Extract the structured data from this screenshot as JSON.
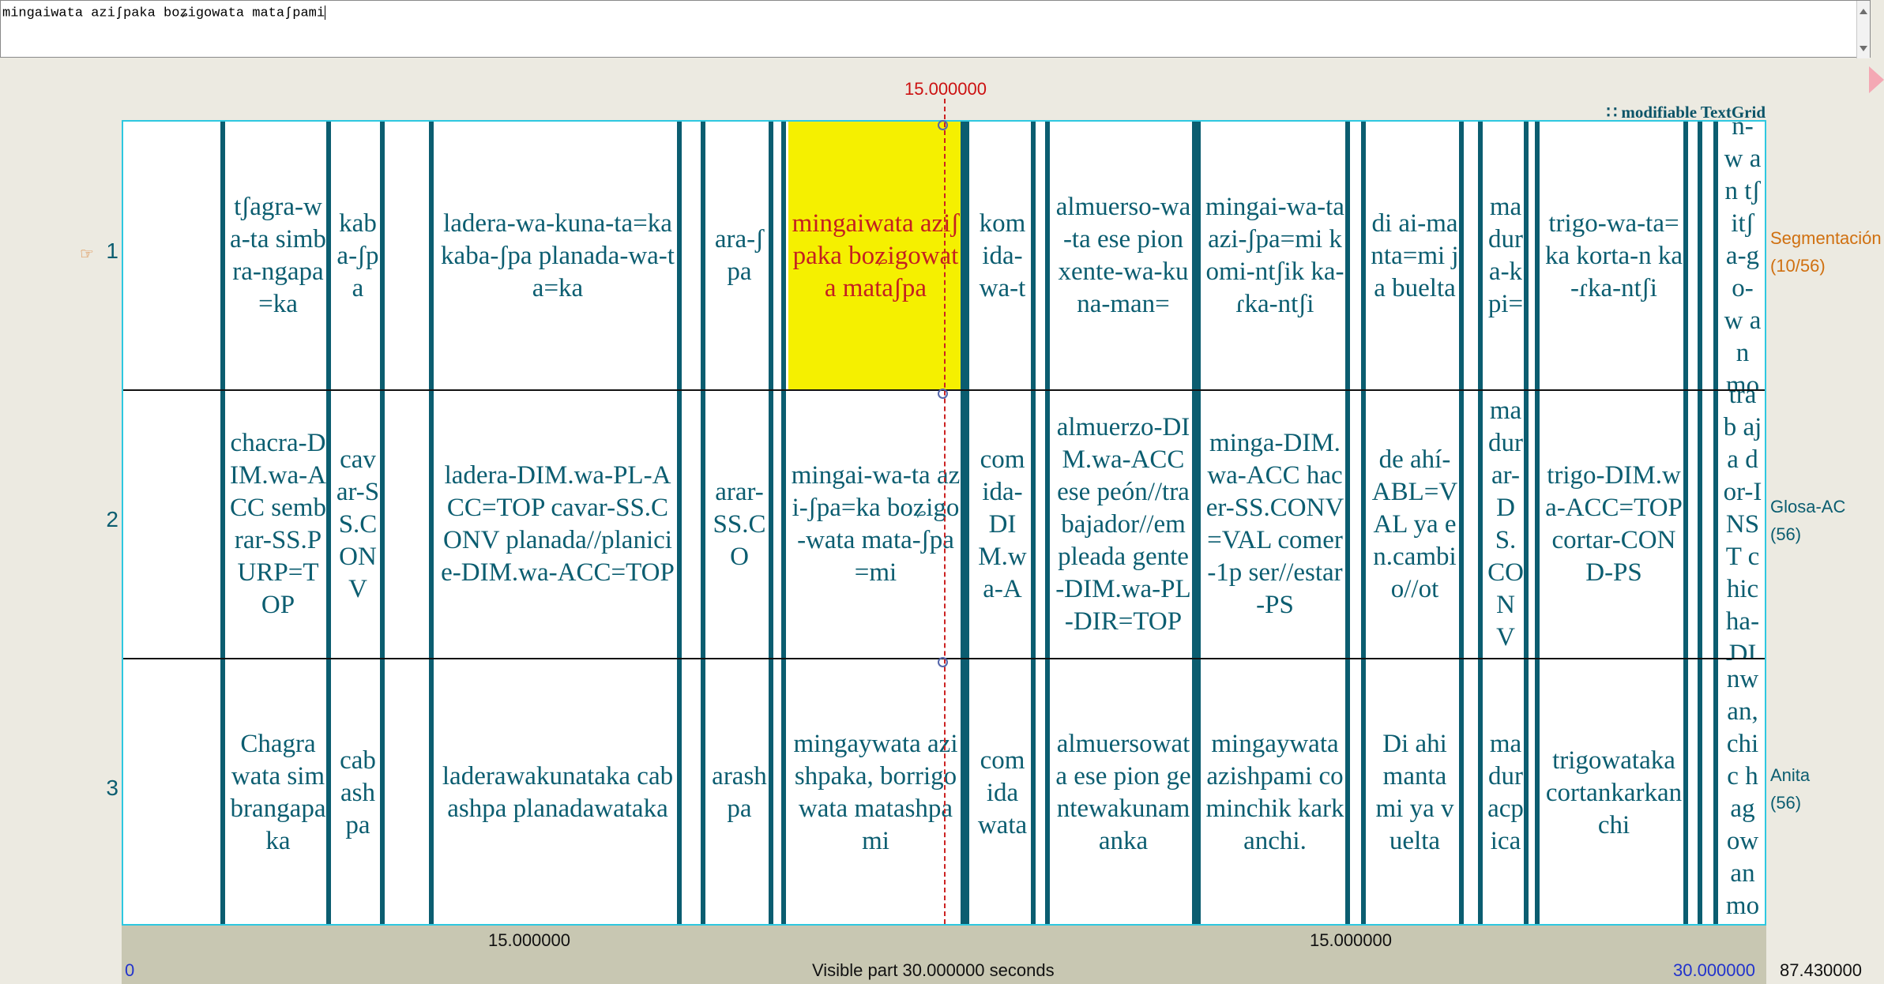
{
  "text_field": {
    "value": "mingaiwata aziʃpaka boʑigowata mataʃpami"
  },
  "header": {
    "cursor_time": "15.000000",
    "modifiable_label": "∷ modifiable TextGrid"
  },
  "tiers": [
    {
      "number": "1",
      "name": "Segmentación",
      "count": "(10/56)",
      "label_color": "#d07010"
    },
    {
      "number": "2",
      "name": "Glosa-AC",
      "count": "(56)",
      "label_color": "#0b5d70"
    },
    {
      "number": "3",
      "name": "Anita",
      "count": "(56)",
      "label_color": "#0b5d70"
    }
  ],
  "intervals": {
    "tier1": [
      "",
      "tʃagra-wa-ta simbra-ngapa=ka",
      "kaba-ʃpa",
      "",
      "ladera-wa-kuna-ta=ka kaba-ʃpa planada-wa-ta=ka",
      "",
      "ara-ʃpa",
      "",
      "mingaiwata aziʃpaka boʑigowata mataʃpa",
      "kom ida-wa-t",
      "",
      "almuerso-wa-ta ese pion xente-wa-kuna-man=",
      "mingai-wa-ta azi-ʃpa=mi komi-ntʃik ka-ɾka-ntʃi",
      "",
      "di ai-manta=mi ja buelta",
      "",
      "ma dur a-k pi=",
      "",
      "trigo-wa-ta=ka korta-n ka-ɾka-ntʃi",
      "",
      "",
      "piu n-w an tʃitʃ a-g o-w an mot"
    ],
    "tier2": [
      "",
      "chacra-DIM.wa-ACC sembrar-SS.PURP=TOP",
      "cavar-SS.CONV",
      "",
      "ladera-DIM.wa-PL-ACC=TOP cavar-SS.CONV planada//planicie-DIM.wa-ACC=TOP",
      "",
      "arar-SS.CO",
      "",
      "mingai-wa-ta azi-ʃpa=ka boʑigo-wata mata-ʃpa=mi",
      "com ida-DI M.wa-A",
      "",
      "almuerzo-DIM.wa-ACC ese peón//trabajador//empleada gente-DIM.wa-PL-DIR=TOP",
      "minga-DIM.wa-ACC hacer-SS.CONV=VAL comer-1p ser//estar-PS",
      "",
      "de ahí-ABL=VAL ya en.cambio//ot",
      "",
      "ma dur ar-DS.CONV",
      "",
      "trigo-DIM.wa-ACC=TOP cortar-COND-PS",
      "",
      "",
      "trab aja dor-INST chic ha-DI"
    ],
    "tier3": [
      "",
      "Chagra wata simbrangapaka",
      "cabashpa",
      "",
      "laderawakunataka cabashpa planadawataka",
      "",
      "arashpa",
      "",
      "mingaywata azishpaka, borrigowata matashpami",
      "com ida wata",
      "",
      "almuersowata ese pion gentewakunamanka",
      "mingaywata azishpami cominchik karkanchi.",
      "",
      "Di ahi manta mi ya vuelta",
      "",
      "ma dur acp ica",
      "",
      "trigowataka cortankarkanchi",
      "",
      "",
      "piu nw an, chic hag ow an mot"
    ]
  },
  "bottom": {
    "left_duration": "15.000000",
    "right_duration": "15.000000",
    "start_time": "0",
    "visible_part": "Visible part 30.000000 seconds",
    "end_time": "30.000000",
    "total_time": "87.430000"
  },
  "colors": {
    "boundary": "#0b5d70",
    "selection": "#f5f000",
    "cursor": "#cc2222",
    "grid_border": "#2ec8e0"
  },
  "icons": [
    "play-icon",
    "pointer-hand-icon",
    "scroll-up-icon",
    "scroll-down-icon"
  ]
}
